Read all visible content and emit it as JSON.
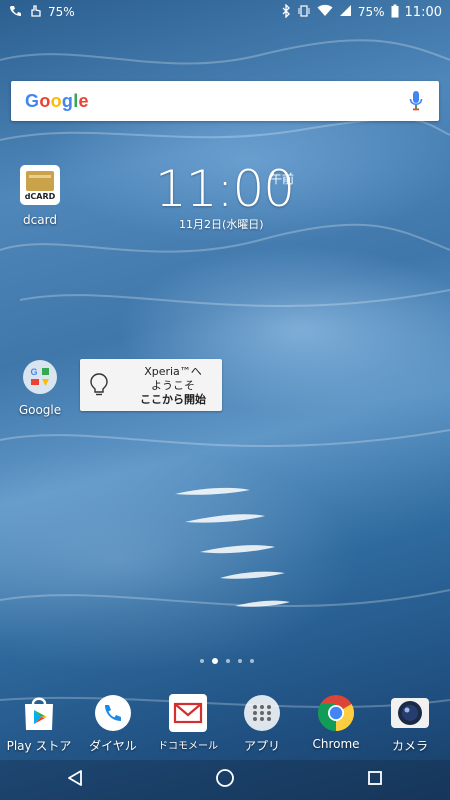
{
  "status_bar": {
    "battery_left": "75%",
    "battery_right": "75%",
    "time": "11:00"
  },
  "search": {
    "logo": "Google",
    "mic_icon": "mic-icon"
  },
  "home_apps": [
    {
      "label": "dcard",
      "icon": "dcard-icon"
    },
    {
      "label": "Google",
      "icon": "google-folder-icon"
    }
  ],
  "clock": {
    "time": "11:00",
    "ampm": "午前",
    "date": "11月2日(水曜日)"
  },
  "xperia_widget": {
    "line1": "Xperia™へ",
    "line2": "ようこそ",
    "line3": "ここから開始"
  },
  "pager": {
    "pages": 5,
    "current": 2
  },
  "dock": [
    {
      "label": "Play ストア",
      "icon": "play-store-icon"
    },
    {
      "label": "ダイヤル",
      "icon": "phone-icon"
    },
    {
      "label": "ドコモメール",
      "icon": "mail-icon"
    },
    {
      "label": "アプリ",
      "icon": "app-drawer-icon"
    },
    {
      "label": "Chrome",
      "icon": "chrome-icon"
    },
    {
      "label": "カメラ",
      "icon": "camera-icon"
    }
  ],
  "nav": {
    "back_icon": "back-icon",
    "home_icon": "home-icon",
    "recents_icon": "recents-icon"
  }
}
